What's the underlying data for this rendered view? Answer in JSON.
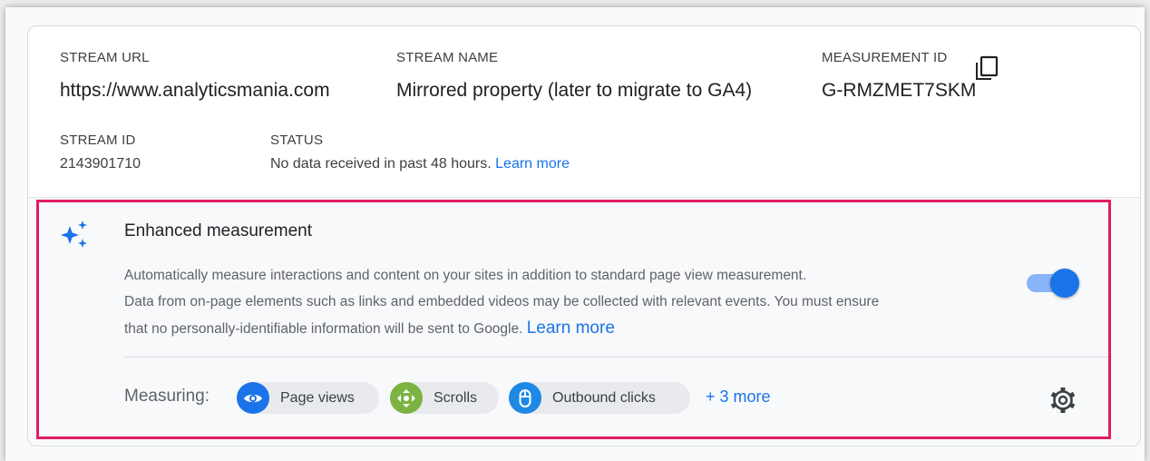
{
  "stream": {
    "url_label": "STREAM URL",
    "url_value": "https://www.analyticsmania.com",
    "name_label": "STREAM NAME",
    "name_value": "Mirrored property (later to migrate to GA4)",
    "mid_label": "MEASUREMENT ID",
    "mid_value": "G-RMZMET7SKM",
    "id_label": "STREAM ID",
    "id_value": "2143901710",
    "status_label": "STATUS",
    "status_text": "No data received in past 48 hours.",
    "status_link": "Learn more"
  },
  "enhanced": {
    "title": "Enhanced measurement",
    "desc_line1": "Automatically measure interactions and content on your sites in addition to standard page view measurement.",
    "desc_line2": "Data from on-page elements such as links and embedded videos may be collected with relevant events. You must ensure",
    "desc_line3": "that no personally-identifiable information will be sent to Google.",
    "learn_more": "Learn more",
    "toggle_on": true,
    "measuring_label": "Measuring:",
    "chips": [
      {
        "label": "Page views",
        "icon": "eye-icon",
        "color": "#1a73e8"
      },
      {
        "label": "Scrolls",
        "icon": "scroll-arrows-icon",
        "color": "#7cb342"
      },
      {
        "label": "Outbound clicks",
        "icon": "mouse-icon",
        "color": "#1e88e5"
      }
    ],
    "more_label": "+ 3 more"
  },
  "colors": {
    "accent": "#1a73e8",
    "highlight_border": "#e21e63"
  }
}
